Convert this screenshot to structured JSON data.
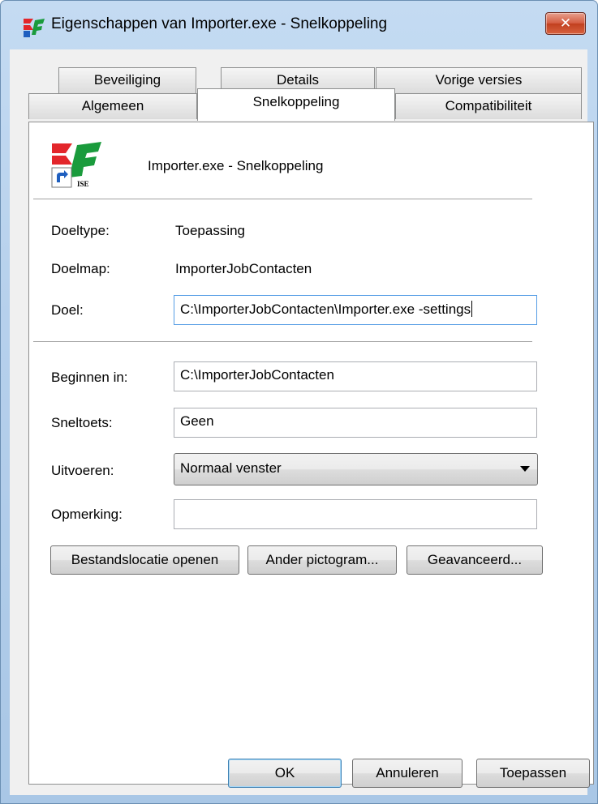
{
  "window": {
    "title": "Eigenschappen van Importer.exe - Snelkoppeling",
    "close_label": "✕"
  },
  "tabs": {
    "row_top": [
      "Beveiliging",
      "Details",
      "Vorige versies"
    ],
    "row_bottom": [
      "Algemeen",
      "Snelkoppeling",
      "Compatibiliteit"
    ],
    "active": "Snelkoppeling"
  },
  "header": {
    "shortcut_name": "Importer.exe - Snelkoppeling",
    "icon": "ke-ise-shortcut-icon",
    "icon_text": "ISE"
  },
  "fields": {
    "doeltype": {
      "label": "Doeltype:",
      "value": "Toepassing"
    },
    "doelmap": {
      "label": "Doelmap:",
      "value": "ImporterJobContacten"
    },
    "doel": {
      "label": "Doel:",
      "value": "C:\\ImporterJobContacten\\Importer.exe -settings"
    },
    "beginnen_in": {
      "label": "Beginnen in:",
      "value": "C:\\ImporterJobContacten"
    },
    "sneltoets": {
      "label": "Sneltoets:",
      "value": "Geen"
    },
    "uitvoeren": {
      "label": "Uitvoeren:",
      "value": "Normaal venster"
    },
    "opmerking": {
      "label": "Opmerking:",
      "value": ""
    }
  },
  "actions": {
    "open_location": "Bestandslocatie openen",
    "change_icon": "Ander pictogram...",
    "advanced": "Geavanceerd..."
  },
  "footer": {
    "ok": "OK",
    "cancel": "Annuleren",
    "apply": "Toepassen"
  },
  "colors": {
    "title_bar": "#b6d0ec",
    "close_button": "#c1401f",
    "focus_border": "#569de5",
    "icon_red": "#e3262b",
    "icon_green": "#1a9b3c"
  }
}
